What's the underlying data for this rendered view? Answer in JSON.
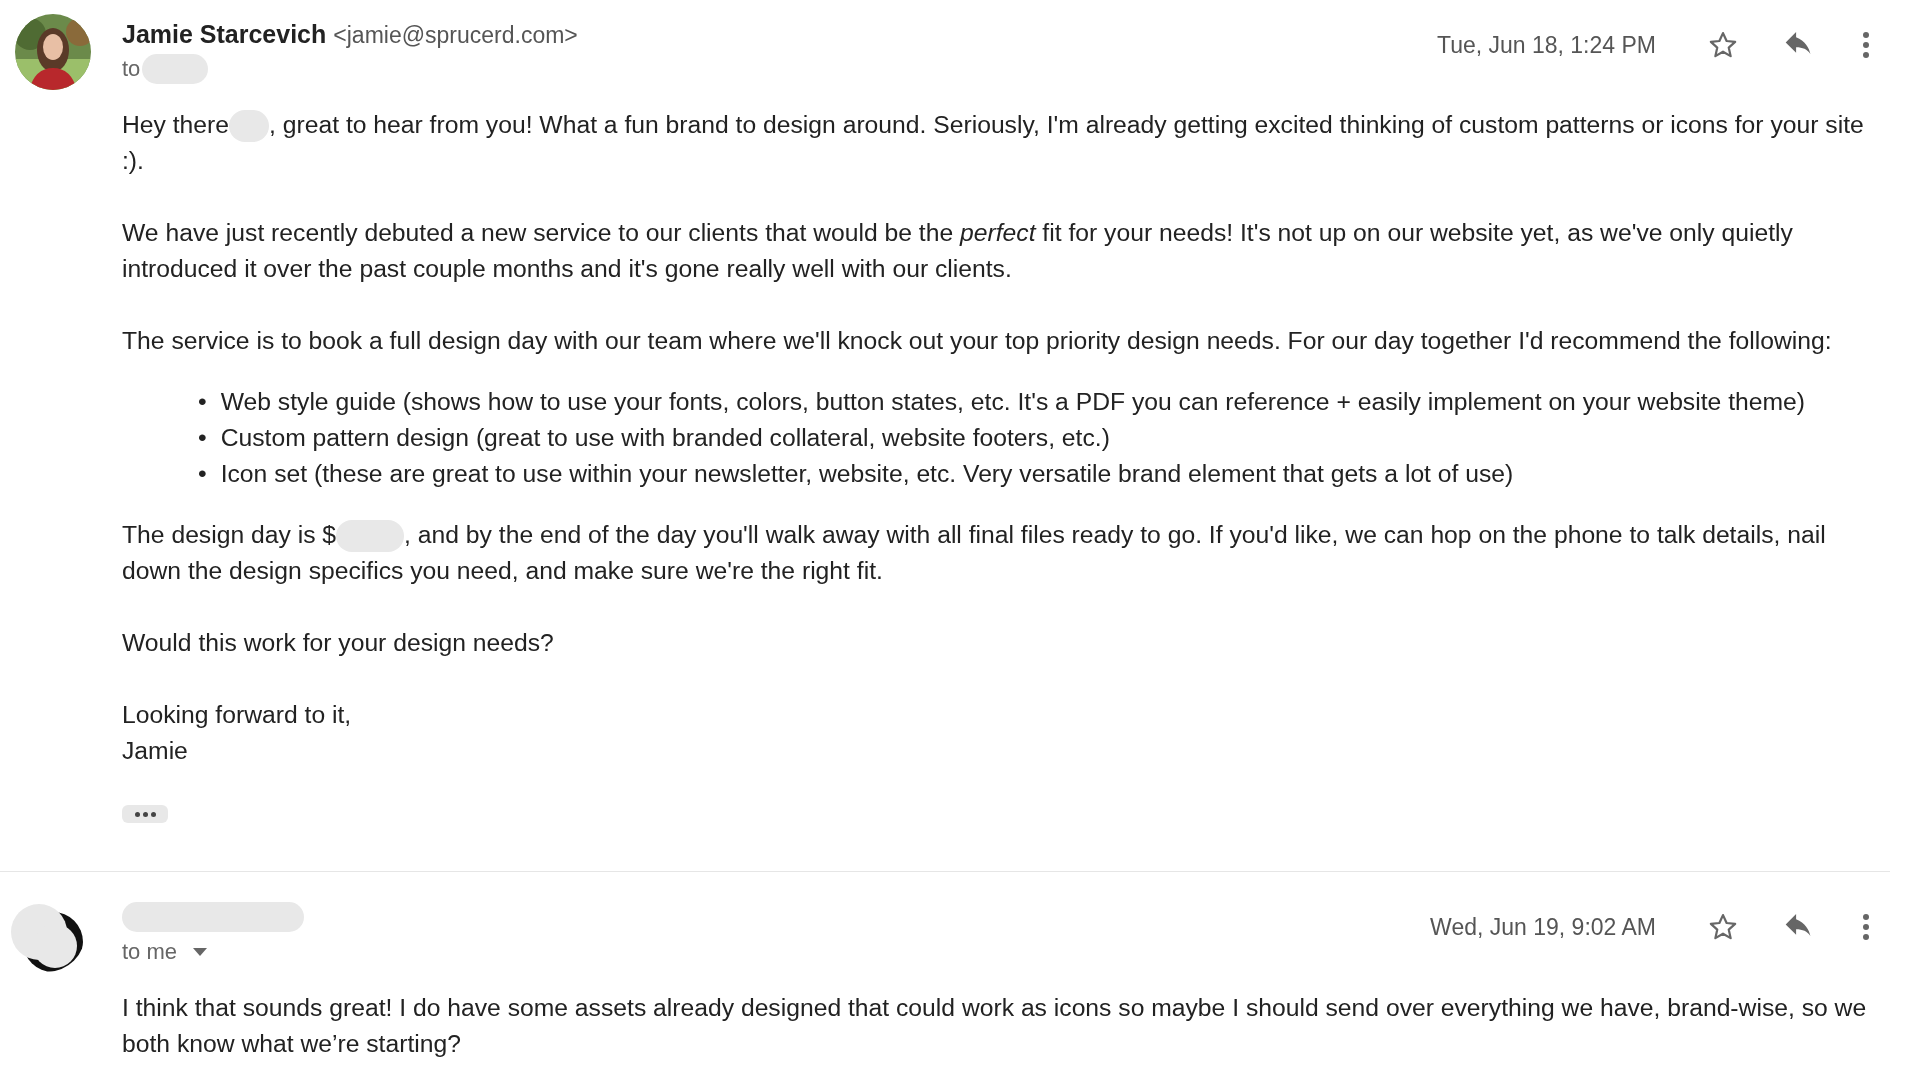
{
  "messages": [
    {
      "sender": {
        "redacted": false,
        "name": "Jamie Starcevich",
        "email": "<jamie@sprucerd.com>"
      },
      "recipient": {
        "label": "to",
        "redacted": true,
        "dropdown": false
      },
      "date": "Tue, Jun 18, 1:24 PM",
      "starred": false,
      "body": [
        {
          "kind": "paragraph",
          "parts": [
            {
              "kind": "text",
              "text": "Hey there"
            },
            {
              "kind": "redacted"
            },
            {
              "kind": "text",
              "text": ", great to hear from you! What a fun brand to design around. Seriously, I'm already getting excited thinking of custom patterns or icons for your site :)."
            }
          ]
        },
        {
          "kind": "paragraph",
          "parts": [
            {
              "kind": "text",
              "text": "We have just recently debuted a new service to our clients that would be the *perfect* fit for your needs! It's not up on our website yet, as we've only quietly introduced it over the past couple months and it's gone really well with our clients."
            }
          ]
        },
        {
          "kind": "paragraph",
          "parts": [
            {
              "kind": "text",
              "text": "The service is to book a full design day with our team where we'll knock out your top priority design needs. For our day together I'd recommend the following:"
            }
          ]
        },
        {
          "kind": "list",
          "items": [
            {
              "marker": "•",
              "text": "Web style guide (shows how to use your fonts, colors, button states, etc. It's a PDF you can reference + easily implement on your website theme)"
            },
            {
              "marker": "•",
              "text": "Custom pattern design (great to use with branded collateral, website footers, etc.)"
            },
            {
              "marker": "•",
              "text": "Icon set (these are great to use within your newsletter, website, etc. Very versatile brand element that gets a lot of use)"
            }
          ]
        },
        {
          "kind": "paragraph",
          "parts": [
            {
              "kind": "text",
              "text": "The design day is $"
            },
            {
              "kind": "redacted"
            },
            {
              "kind": "text",
              "text": ", and by the end of the day you'll walk away with all final files ready to go. If you'd like, we can hop on the phone to talk details, nail down the design specifics you need, and make sure we're the right fit."
            }
          ]
        },
        {
          "kind": "paragraph",
          "parts": [
            {
              "kind": "text",
              "text": "Would this work for your design needs?"
            }
          ]
        },
        {
          "kind": "signoff",
          "lines": [
            "Looking forward to it,",
            "Jamie"
          ]
        }
      ],
      "trimmed": true
    },
    {
      "sender": {
        "redacted": true,
        "avatar": {
          "kind": "redacted"
        }
      },
      "recipient": {
        "label": "to me",
        "redacted": false,
        "dropdown": true
      },
      "date": "Wed, Jun 19, 9:02 AM",
      "starred": false,
      "body": [
        {
          "kind": "paragraph",
          "parts": [
            {
              "kind": "text",
              "text": "I think that sounds great! I do have some assets already designed that could work as icons so maybe I should send over everything we have, brand-wise, so we both know what we’re starting?"
            }
          ]
        }
      ],
      "trimmed": false
    }
  ]
}
